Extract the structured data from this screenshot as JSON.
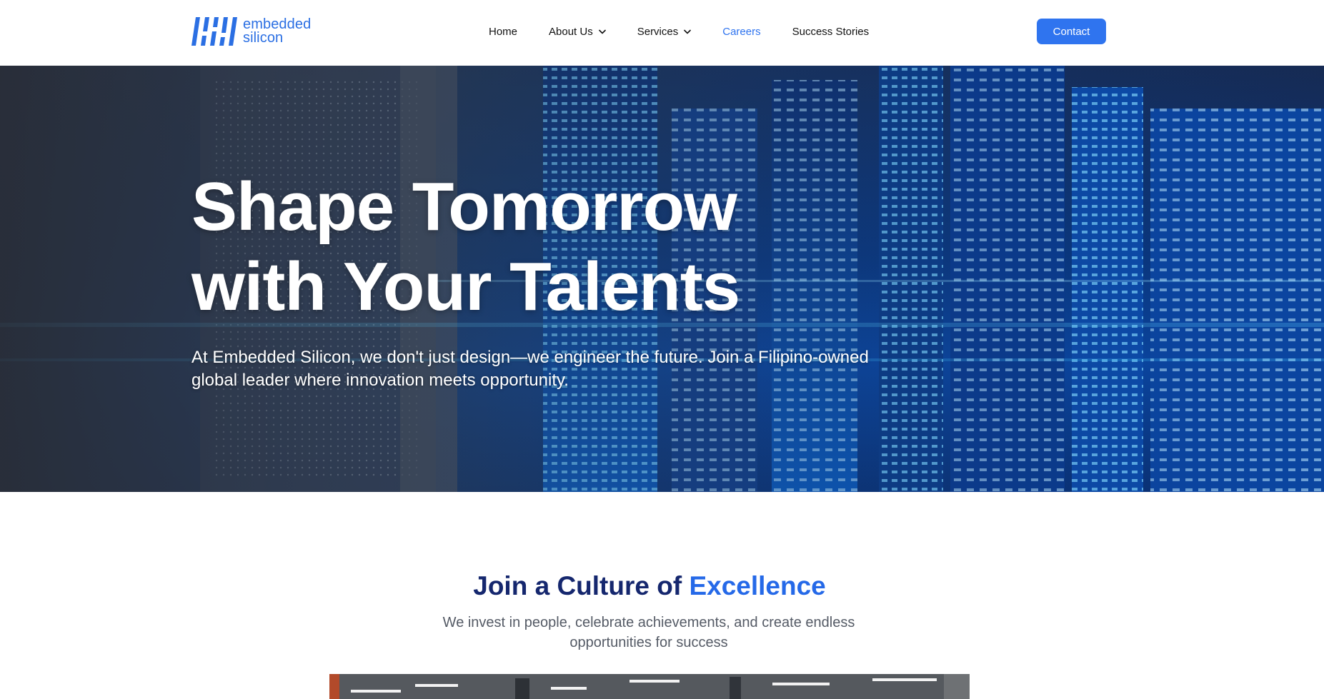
{
  "brand": {
    "name_line1": "embedded",
    "name_line2": "silicon",
    "logo_icon": "embedded-silicon-logo",
    "accent_color": "#2f74ef"
  },
  "nav": {
    "items": [
      {
        "label": "Home",
        "has_dropdown": false,
        "active": false
      },
      {
        "label": "About Us",
        "has_dropdown": true,
        "active": false
      },
      {
        "label": "Services",
        "has_dropdown": true,
        "active": false
      },
      {
        "label": "Careers",
        "has_dropdown": false,
        "active": true
      },
      {
        "label": "Success Stories",
        "has_dropdown": false,
        "active": false
      }
    ],
    "contact_label": "Contact",
    "dropdown_icon": "chevron-down-icon"
  },
  "hero": {
    "title_line1": "Shape Tomorrow",
    "title_line2": "with Your Talents",
    "subtitle": "At Embedded Silicon, we don't just design—we engineer the future. Join a Filipino-owned global leader where innovation meets opportunity."
  },
  "culture": {
    "title_prefix": "Join a Culture of",
    "title_accent": "Excellence",
    "subtitle": "We invest in people, celebrate achievements, and create endless opportunities for success",
    "title_color": "#15276e",
    "accent_color": "#2569e8"
  }
}
